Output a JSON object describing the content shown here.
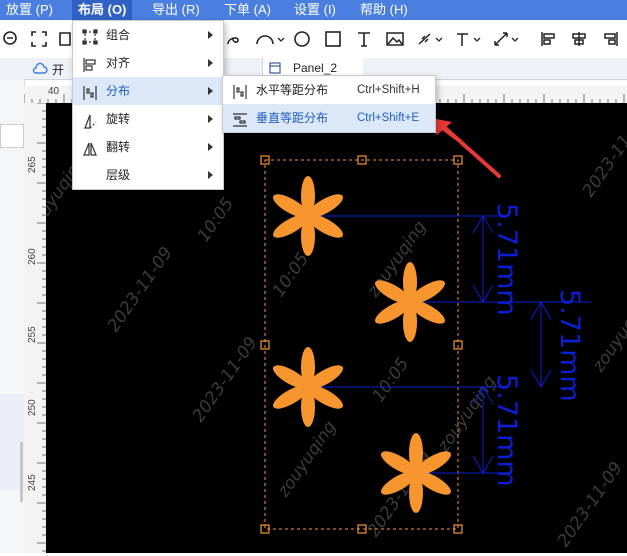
{
  "menubar": {
    "items": [
      {
        "label": "放置 (P)"
      },
      {
        "label": "布局 (O)"
      },
      {
        "label": "导出 (R)"
      },
      {
        "label": "下单 (A)"
      },
      {
        "label": "设置 (I)"
      },
      {
        "label": "帮助 (H)"
      }
    ]
  },
  "tabs": {
    "left_label": "开",
    "panel_label": "Panel_2"
  },
  "ruler": {
    "h_label": "40",
    "v_labels": [
      "265",
      "260",
      "255",
      "250",
      "245"
    ]
  },
  "layout_menu": {
    "items": [
      {
        "label": "组合",
        "icon": "group-icon"
      },
      {
        "label": "对齐",
        "icon": "align-icon"
      },
      {
        "label": "分布",
        "icon": "distribute-icon"
      },
      {
        "label": "旋转",
        "icon": "rotate-icon"
      },
      {
        "label": "翻转",
        "icon": "flip-icon"
      },
      {
        "label": "层级",
        "icon": ""
      }
    ]
  },
  "distribute_menu": {
    "items": [
      {
        "label": "水平等距分布",
        "shortcut": "Ctrl+Shift+H",
        "icon": "horizontal-distribute-icon"
      },
      {
        "label": "垂直等距分布",
        "shortcut": "Ctrl+Shift+E",
        "icon": "vertical-distribute-icon"
      }
    ]
  },
  "dimensions": {
    "dim1": "5.71mm",
    "dim2": "5.71mm",
    "dim3": "5.71mm"
  },
  "watermark": {
    "date": "2023-11-09",
    "time": "10:05",
    "user": "zouyuqing"
  },
  "colors": {
    "menubar": "#4a7fe0",
    "canvas": "#000000",
    "shape": "#f7962e",
    "dimension": "#0a1fd6",
    "selection": "#f7962e",
    "arrow": "#e53935"
  }
}
